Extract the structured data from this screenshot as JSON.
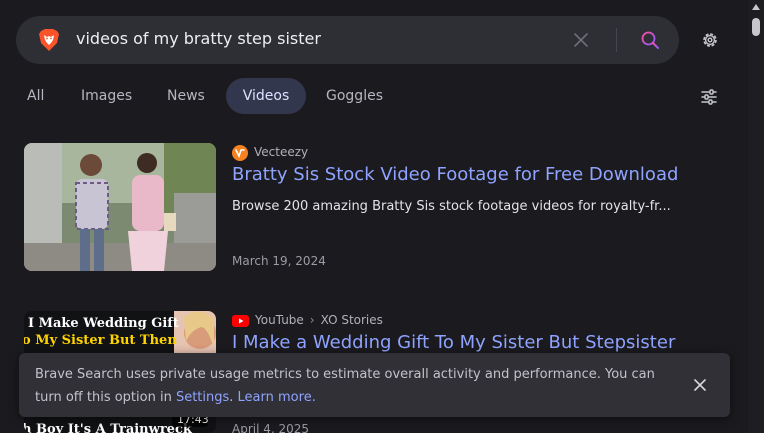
{
  "search": {
    "query": "videos of my bratty step sister",
    "logo_icon": "brave-lion-icon",
    "clear_icon": "close-icon",
    "search_icon": "search-icon",
    "settings_icon": "gear-icon"
  },
  "tabs": [
    {
      "label": "All",
      "active": false
    },
    {
      "label": "Images",
      "active": false
    },
    {
      "label": "News",
      "active": false
    },
    {
      "label": "Videos",
      "active": true
    },
    {
      "label": "Goggles",
      "active": false
    }
  ],
  "filter_icon": "sliders-icon",
  "results": [
    {
      "source": "Vecteezy",
      "favicon": "vecteezy-icon",
      "title": "Bratty Sis Stock Video Footage for Free Download",
      "description": "Browse 200 amazing Bratty Sis stock footage videos for royalty-fr...",
      "date": "March 19, 2024"
    },
    {
      "source": "YouTube",
      "source_sub": "XO Stories",
      "favicon": "youtube-icon",
      "title": "I Make a Wedding Gift To My Sister But Stepsister",
      "thumb_lines": [
        "I Make Wedding Gift",
        "o My Sister But Then",
        "h Boy It's A Trainwreck"
      ],
      "duration": "17:43",
      "date": "April 4, 2025"
    }
  ],
  "toast": {
    "text": "Brave Search uses private usage metrics to estimate overall activity and performance. You can turn off this option in ",
    "settings_link": "Settings",
    "learn_more": "Learn more.",
    "close_icon": "close-icon"
  },
  "colors": {
    "background": "#1b1b1f",
    "link": "#8fa3ff",
    "active_tab": "#33374e"
  }
}
